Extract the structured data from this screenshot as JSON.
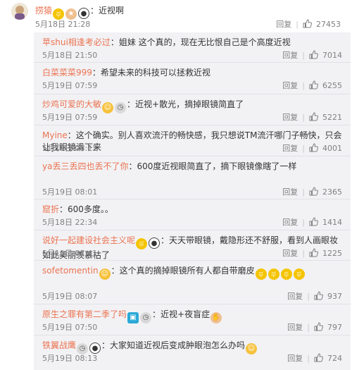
{
  "main_post": {
    "username": "捞猿",
    "text": "：近视啊",
    "time": "5月18日 21:28",
    "reply_label": "回复",
    "likes": "27453"
  },
  "comments": [
    {
      "user": "苹shui相逢考必过",
      "text": "：姐妹 这个真的，现在无比恨自己是个高度近视",
      "time": "5月18日 21:50",
      "reply": "回复",
      "likes": "7014"
    },
    {
      "user": "白菜菜菜999",
      "text": "：希望未来的科技可以拯救近视",
      "time": "5月19日 07:59",
      "reply": "回复",
      "likes": "6255"
    },
    {
      "user": "炒鸡可爱的大敏",
      "text": "：近视+散光，摘掉眼镜简直了",
      "time": "5月19日 07:59",
      "reply": "回复",
      "likes": "5221"
    },
    {
      "user": "Myine",
      "text": "：这个确实。别人喜欢流汗的畅快感，我只想说TM流汗哪门子畅快，只会让我眼镜滑下来",
      "time": "5月19日 08:12",
      "reply": "回复",
      "likes": "4001"
    },
    {
      "user": "ya丢三丢四也丢不了你",
      "text": "：600度近视眼简直了，摘下眼镜像瞎了一样",
      "time": "5月19日 08:01",
      "reply": "回复",
      "likes": "2365"
    },
    {
      "user": "窟折",
      "text": "：600多度。。",
      "time": "5月18日 22:34",
      "reply": "回复",
      "likes": "1414"
    },
    {
      "user": "说好一起建设社会主义呢",
      "text": "：天天带眼镜，戴隐形还不舒服，看到人画眼妆如此美丽羡慕枯了",
      "time": "5月19日 07:41",
      "reply": "回复",
      "likes": "1225"
    },
    {
      "user": "sofetomentin",
      "text": "：这个真的",
      "text2": "摘掉眼镜所有人都自带磨皮",
      "time": "5月19日 08:07",
      "reply": "回复",
      "likes": "937"
    },
    {
      "user": "原生之罪有第二季了吗",
      "text": "：近视+夜盲症",
      "time": "5月19日 07:50",
      "reply": "回复",
      "likes": "797"
    },
    {
      "user": "铁翼战鹰",
      "text": "：大家知道近视后变成肿眼泡怎么办吗",
      "time": "5月19日 08:13",
      "reply": "回复",
      "likes": "724"
    }
  ],
  "icons": {
    "thumb": "thumbs-up-icon",
    "emoji": [
      "cry-emoji",
      "panda-emoji",
      "clock-emoji",
      "flower-emoji",
      "hand-emoji",
      "face-emoji",
      "camera-emoji"
    ]
  },
  "colors": {
    "username": "#eb7350",
    "meta": "#808080",
    "panel": "#f2f2f5"
  }
}
